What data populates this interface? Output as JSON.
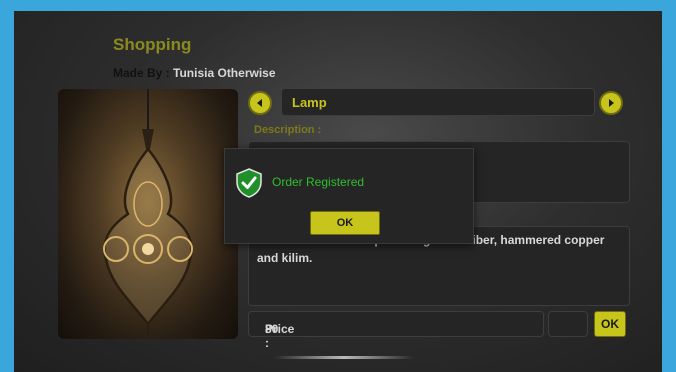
{
  "app": {
    "title": "Shopping",
    "made_by_label": "Made By :",
    "made_by_name": "Tunisia Otherwise"
  },
  "product": {
    "name": "Lamp",
    "description_label": "Description :",
    "description_text": "... which mixes burlap and vegetable fiber, hammered copper and kilim.",
    "price_label": "Price :",
    "price_value": "80",
    "ok_label": "OK"
  },
  "dialog": {
    "message": "Order Registered",
    "ok_label": "OK",
    "icon": "shield-check-icon"
  },
  "colors": {
    "accent": "#c7c41c",
    "success": "#2fbf2f",
    "background": "#3aa6dc"
  }
}
